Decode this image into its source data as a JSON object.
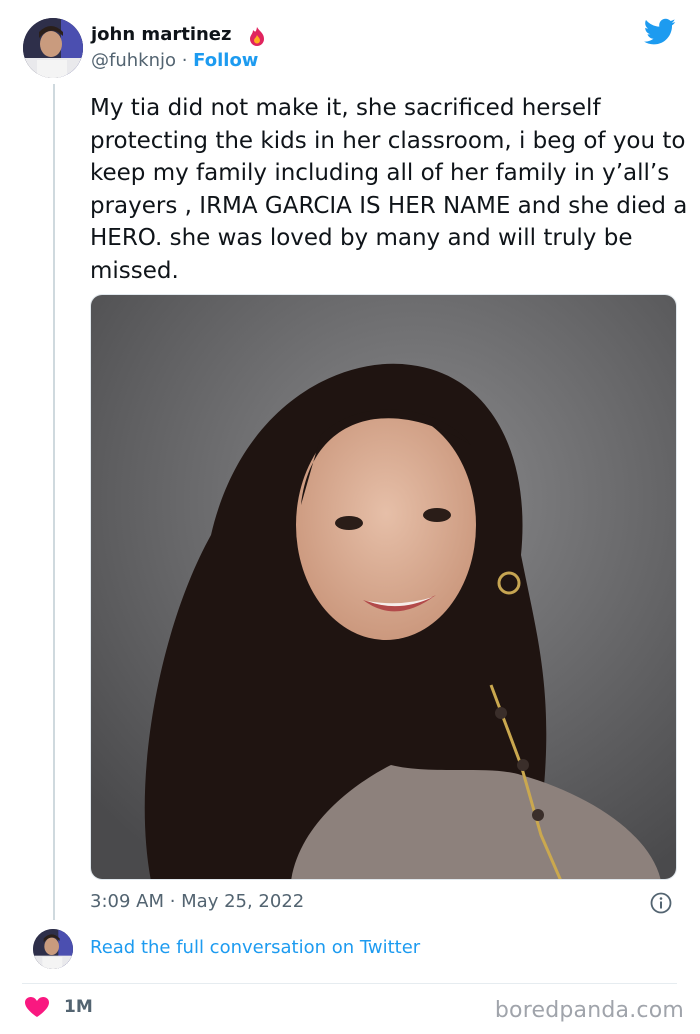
{
  "author": {
    "name": "john martinez",
    "handle": "@fuhknjo",
    "separator": " · ",
    "follow_label": "Follow"
  },
  "tweet": {
    "text": "My tia did not make it, she sacrificed herself protecting the kids in her classroom, i beg of you to keep my family including all of her family in y’all’s prayers , IRMA GARCIA IS HER NAME and she died a HERO. she was loved by many and will truly be missed.",
    "timestamp": "3:09 AM · May 25, 2022"
  },
  "footer": {
    "read_link": "Read the full conversation on Twitter",
    "likes": "1M"
  },
  "watermark": "boredpanda.com",
  "colors": {
    "accent": "#1d9bf0",
    "heart": "#f91880",
    "muted": "#536471"
  },
  "icons": [
    "twitter-bird-icon",
    "flame-icon",
    "info-icon",
    "heart-icon"
  ]
}
